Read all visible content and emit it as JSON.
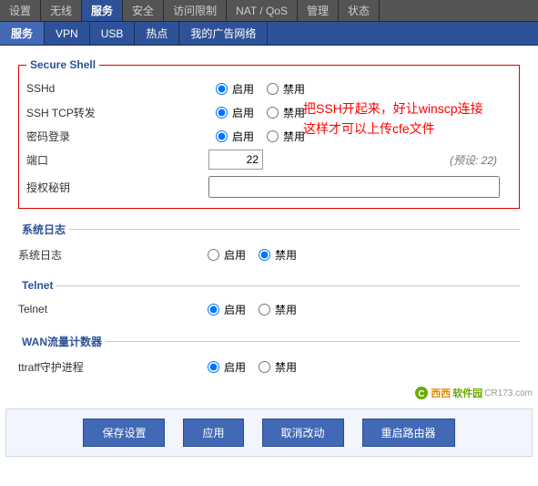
{
  "topnav": {
    "tabs": [
      "设置",
      "无线",
      "服务",
      "安全",
      "访问限制",
      "NAT / QoS",
      "管理",
      "状态"
    ],
    "active": 2
  },
  "subnav": {
    "tabs": [
      "服务",
      "VPN",
      "USB",
      "热点",
      "我的广告网络"
    ],
    "active": 0
  },
  "common": {
    "enable": "启用",
    "disable": "禁用"
  },
  "ssh": {
    "legend": "Secure Shell",
    "sshd_label": "SSHd",
    "sshd_value": "enable",
    "tcpfwd_label": "SSH TCP转发",
    "tcpfwd_value": "enable",
    "pwdlogin_label": "密码登录",
    "pwdlogin_value": "enable",
    "port_label": "端口",
    "port_value": "22",
    "port_default": "(预设: 22)",
    "authkey_label": "授权秘钥",
    "authkey_value": ""
  },
  "annotation": {
    "line1": "把SSH开起来，好让winscp连接",
    "line2": "这样才可以上传cfe文件"
  },
  "syslog": {
    "legend": "系统日志",
    "label": "系统日志",
    "value": "disable"
  },
  "telnet": {
    "legend": "Telnet",
    "label": "Telnet",
    "value": "enable"
  },
  "wan": {
    "legend": "WAN流量计数器",
    "label": "ttraff守护进程",
    "value": "enable"
  },
  "watermark": {
    "text_a": "西西",
    "text_b": "软件园",
    "url": "CR173.com"
  },
  "footer": {
    "save": "保存设置",
    "apply": "应用",
    "cancel": "取消改动",
    "reboot": "重启路由器"
  }
}
